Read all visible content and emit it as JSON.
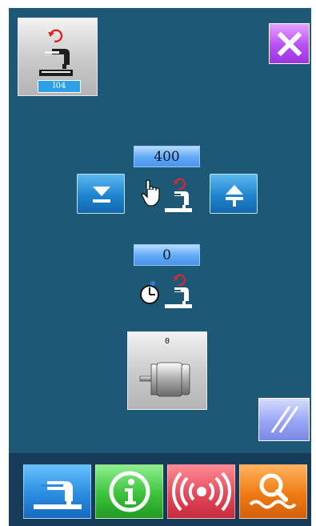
{
  "header": {
    "mode_badge": "I04"
  },
  "speed": {
    "value": "400"
  },
  "delay": {
    "value": "0"
  },
  "motor": {
    "value": "0"
  },
  "colors": {
    "screen_bg": "#1e5877",
    "bottom_bar": "#163c59",
    "close_button": "#c060f0",
    "sewing_button": "#2a8ce0",
    "info_button": "#3cc23c",
    "signal_button": "#e34b5c",
    "search_button": "#ef7b14"
  },
  "icons": {
    "mode": "sewing-machine-reset-icon",
    "close": "close-icon",
    "decrease": "arrow-down-to-line-icon",
    "increase": "arrow-up-from-line-icon",
    "manual": "hand-sewing-machine-icon",
    "timer": "clock-sewing-machine-icon",
    "motor": "motor-icon",
    "slash": "double-slash-icon",
    "nav_sewing": "sewing-machine-icon",
    "nav_info": "info-icon",
    "nav_signal": "signal-icon",
    "nav_search": "search-wave-icon"
  }
}
